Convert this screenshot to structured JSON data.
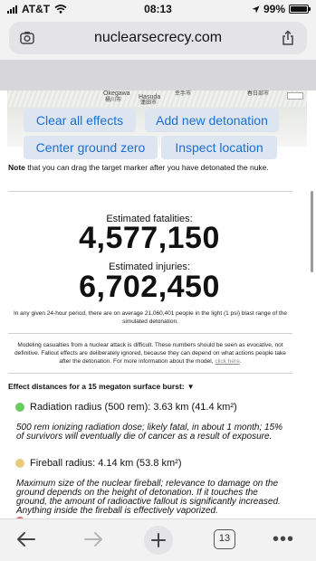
{
  "status_bar": {
    "carrier": "AT&T",
    "time": "08:13",
    "battery": "99%",
    "battery_level": 0.99
  },
  "browser": {
    "url": "nuclearsecrecy.com",
    "tab_count": "13"
  },
  "map": {
    "labels": [
      "Okegawa",
      "桶川市",
      "Hasuda",
      "蓮田市",
      "幸手市",
      "春日部市"
    ]
  },
  "buttons": {
    "clear": "Clear all effects",
    "add": "Add new detonation",
    "center": "Center ground zero",
    "inspect": "Inspect location"
  },
  "note": {
    "bold": "Note",
    "rest": " that you can drag the target marker after you have detonated the nuke."
  },
  "fatalities": {
    "label": "Estimated fatalities:",
    "value": "4,577,150"
  },
  "injuries": {
    "label": "Estimated injuries:",
    "value": "6,702,450"
  },
  "population_note": "In any given 24-hour period, there are on average 21,060,401 people in the light (1 psi) blast range of the simulated detonation.",
  "disclaimer": {
    "text": "Modeling casualties from a nuclear attack is difficult. These numbers should be seen as evocative, not definitive. Fallout effects are deliberately ignored, because they can depend on what actions people take after the detonation. For more information about the model,",
    "link": "click here",
    "end": "."
  },
  "effects": {
    "heading": "Effect distances for a 15 megaton surface burst:",
    "items": [
      {
        "label": "Radiation radius (500 rem): 3.63 km (41.4 km²)",
        "color": "#66cc5e",
        "description": "500 rem ionizing radiation dose; likely fatal, in about 1 month; 15% of survivors will eventually die of cancer as a result of exposure."
      },
      {
        "label": "Fireball radius: 4.14 km (53.8 km²)",
        "color": "#e8cc7a",
        "description": "Maximum size of the nuclear fireball; relevance to damage on the ground depends on the height of detonation. If it touches the ground, the amount of radioactive fallout is significantly increased. Anything inside the fireball is effectively vaporized."
      }
    ]
  }
}
